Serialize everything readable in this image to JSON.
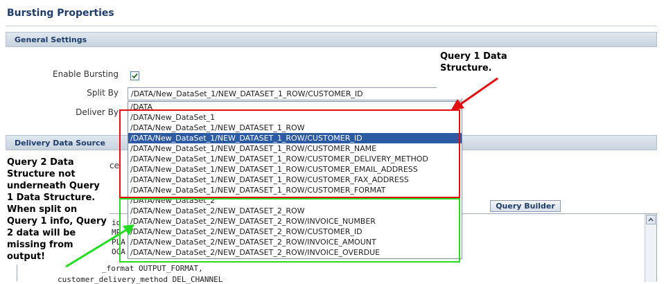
{
  "page_title": "Bursting Properties",
  "sections": {
    "general": "General Settings",
    "delivery": "Delivery Data Source"
  },
  "form": {
    "enable_bursting_label": "Enable Bursting",
    "enable_bursting_checked": true,
    "split_by_label": "Split By",
    "split_by_value": "/DATA/New_DataSet_1/NEW_DATASET_1_ROW/CUSTOMER_ID",
    "deliver_by_label": "Deliver By",
    "delivery_partial_label": "ce"
  },
  "dropdown_options": [
    "/DATA",
    "/DATA/New_DataSet_1",
    "/DATA/New_DataSet_1/NEW_DATASET_1_ROW",
    "/DATA/New_DataSet_1/NEW_DATASET_1_ROW/CUSTOMER_ID",
    "/DATA/New_DataSet_1/NEW_DATASET_1_ROW/CUSTOMER_NAME",
    "/DATA/New_DataSet_1/NEW_DATASET_1_ROW/CUSTOMER_DELIVERY_METHOD",
    "/DATA/New_DataSet_1/NEW_DATASET_1_ROW/CUSTOMER_EMAIL_ADDRESS",
    "/DATA/New_DataSet_1/NEW_DATASET_1_ROW/CUSTOMER_FAX_ADDRESS",
    "/DATA/New_DataSet_1/NEW_DATASET_1_ROW/CUSTOMER_FORMAT",
    "/DATA/New_DataSet_2",
    "/DATA/New_DataSet_2/NEW_DATASET_2_ROW",
    "/DATA/New_DataSet_2/NEW_DATASET_2_ROW/INVOICE_NUMBER",
    "/DATA/New_DataSet_2/NEW_DATASET_2_ROW/CUSTOMER_ID",
    "/DATA/New_DataSet_2/NEW_DATASET_2_ROW/INVOICE_AMOUNT",
    "/DATA/New_DataSet_2/NEW_DATASET_2_ROW/INVOICE_OVERDUE"
  ],
  "selected_option_index": 3,
  "query_builder_label": "Query Builder",
  "sql_lines": [
    "id",
    "MP",
    "PLA",
    "OCA",
    "_format OUTPUT_FORMAT,",
    "customer_delivery_method DEL_CHANNEL"
  ],
  "annotations": {
    "query1": "Query 1 Data Structure.",
    "query2": "Query 2 Data Structure not underneath Query 1 Data Structure. When split on Query 1 info, Query 2 data will be missing from output!"
  },
  "colors": {
    "red_annotation": "#e01010",
    "green_annotation": "#22dd22",
    "selection": "#2c5aa3",
    "header_text": "#1f3d6b"
  }
}
